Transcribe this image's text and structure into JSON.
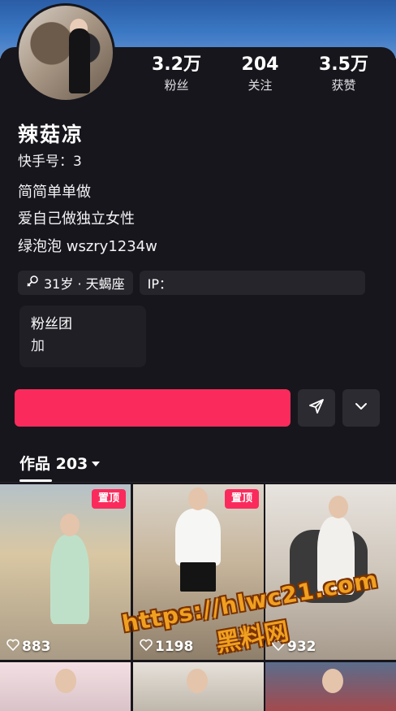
{
  "profile": {
    "stats": [
      {
        "value": "3.2万",
        "label": "粉丝"
      },
      {
        "value": "204",
        "label": "关注"
      },
      {
        "value": "3.5万",
        "label": "获赞"
      }
    ],
    "name": "辣菇凉",
    "kuaishou_id": "快手号：3",
    "bio_line1": "简简单单做",
    "bio_line2": "爱自己做独立女性",
    "bio_line3": "绿泡泡 wszry1234w",
    "tag_age": "31岁 · 天蝎座",
    "tag_ip": "IP："
  },
  "fans_group": {
    "title": "粉丝团",
    "subtitle": "加"
  },
  "actions": {
    "follow_label": "",
    "share_icon": "send-icon",
    "more_icon": "chevron-down-icon"
  },
  "tab": {
    "label": "作品 203",
    "dropdown_icon": "caret-down-icon"
  },
  "videos": [
    {
      "pinned": "置顶",
      "likes": "883"
    },
    {
      "pinned": "置顶",
      "likes": "1198"
    },
    {
      "pinned": "",
      "likes": "932"
    },
    {
      "pinned": "",
      "likes": ""
    },
    {
      "pinned": "",
      "likes": ""
    },
    {
      "pinned": "",
      "likes": ""
    }
  ],
  "watermark": {
    "url": "https://hlwc21.com",
    "text": "黑料网"
  },
  "colors": {
    "accent": "#fa2b5c",
    "background": "#17161c",
    "banner": "#3b78c4",
    "watermark": "#f0a020"
  }
}
